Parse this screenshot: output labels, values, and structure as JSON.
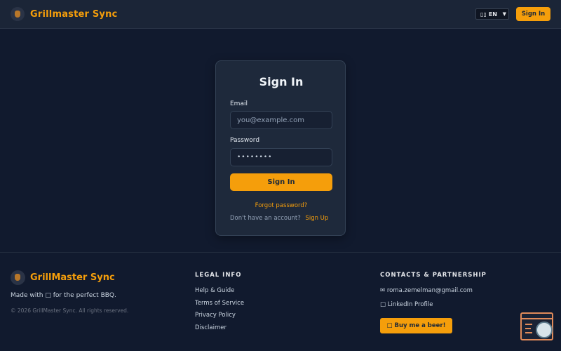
{
  "header": {
    "brand": "Grillmaster Sync",
    "language": "EN",
    "signin_label": "Sign In"
  },
  "card": {
    "title": "Sign In",
    "email_label": "Email",
    "email_placeholder": "you@example.com",
    "password_label": "Password",
    "password_value": "••••••••",
    "submit_label": "Sign In",
    "forgot_label": "Forgot password?",
    "no_account_text": "Don't have an account?",
    "signup_label": "Sign Up"
  },
  "footer": {
    "brand": "GrillMaster Sync",
    "tagline": "Made with □ for the perfect BBQ.",
    "copyright": "© 2026 GrillMaster Sync. All rights reserved.",
    "legal": {
      "heading": "LEGAL INFO",
      "links": [
        "Help & Guide",
        "Terms of Service",
        "Privacy Policy",
        "Disclaimer"
      ]
    },
    "contacts": {
      "heading": "CONTACTS & PARTNERSHIP",
      "email": "✉ roma.zemelman@gmail.com",
      "linkedin": "□ LinkedIn Profile",
      "beer_button": "□ Buy me a beer!"
    }
  },
  "colors": {
    "accent": "#f59e0b",
    "background": "#111a2e",
    "card": "#1e293b"
  }
}
